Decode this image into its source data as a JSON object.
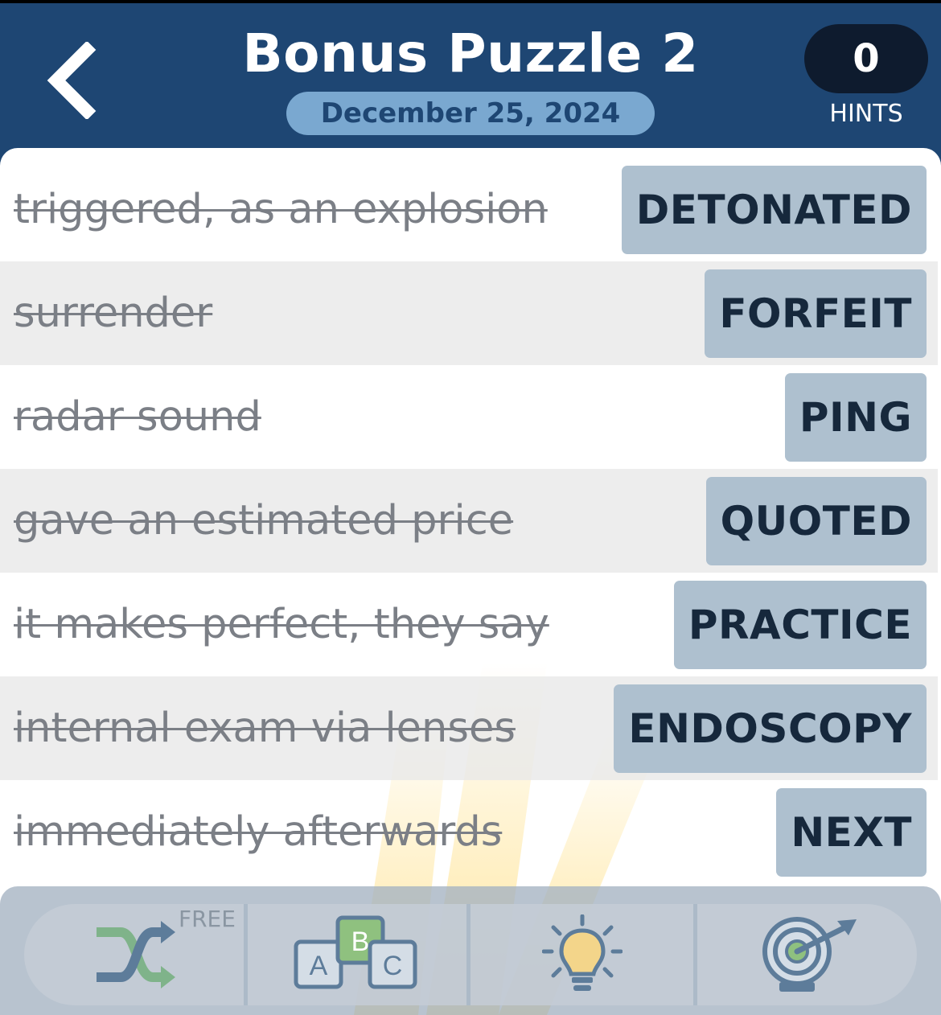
{
  "header": {
    "title": "Bonus Puzzle 2",
    "date": "December 25, 2024",
    "hints_count": "0",
    "hints_label": "HINTS"
  },
  "clues": [
    {
      "clue": "triggered, as an explosion",
      "answer": "DETONATED"
    },
    {
      "clue": "surrender",
      "answer": "FORFEIT"
    },
    {
      "clue": "radar sound",
      "answer": "PING"
    },
    {
      "clue": "gave an estimated price",
      "answer": "QUOTED"
    },
    {
      "clue": "it makes perfect, they say",
      "answer": "PRACTICE"
    },
    {
      "clue": "internal exam via lenses",
      "answer": "ENDOSCOPY"
    },
    {
      "clue": "immediately afterwards",
      "answer": "NEXT"
    }
  ],
  "toolbar": {
    "shuffle_badge": "FREE",
    "letter_blocks": [
      "A",
      "B",
      "C"
    ],
    "tools": [
      "shuffle-icon",
      "abc-blocks-icon",
      "lightbulb-icon",
      "target-icon"
    ]
  },
  "colors": {
    "header_bg": "#1e4673",
    "answer_tile": "#aec0cf",
    "date_pill": "#7aa8d0",
    "hint_pill": "#0e1b2e"
  }
}
